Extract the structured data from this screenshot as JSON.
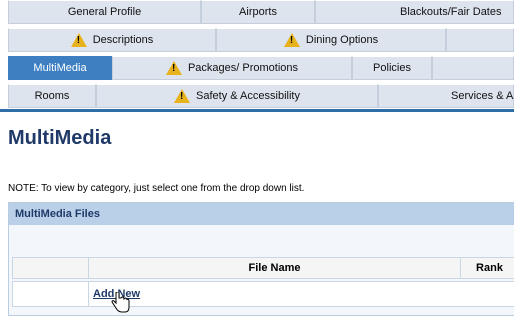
{
  "tabs": {
    "row1": [
      "General Profile",
      "Airports",
      "Blackouts/Fair Dates"
    ],
    "row2": [
      "Descriptions",
      "Dining Options",
      ""
    ],
    "row3": [
      "MultiMedia",
      "Packages/ Promotions",
      "Policies",
      ""
    ],
    "row4": [
      "Rooms",
      "Safety & Accessibility",
      "Services & A"
    ]
  },
  "page": {
    "title": "MultiMedia",
    "note": "NOTE: To view by category, just select one from the drop down list."
  },
  "panel": {
    "header": "MultiMedia Files",
    "columns": [
      "",
      "File Name",
      "Rank"
    ],
    "add_link": "Add New"
  },
  "colors": {
    "active_tab": "#3d7fc1",
    "tab": "#dde4ee",
    "title": "#1f3a68",
    "warning": "#e8b21d"
  }
}
